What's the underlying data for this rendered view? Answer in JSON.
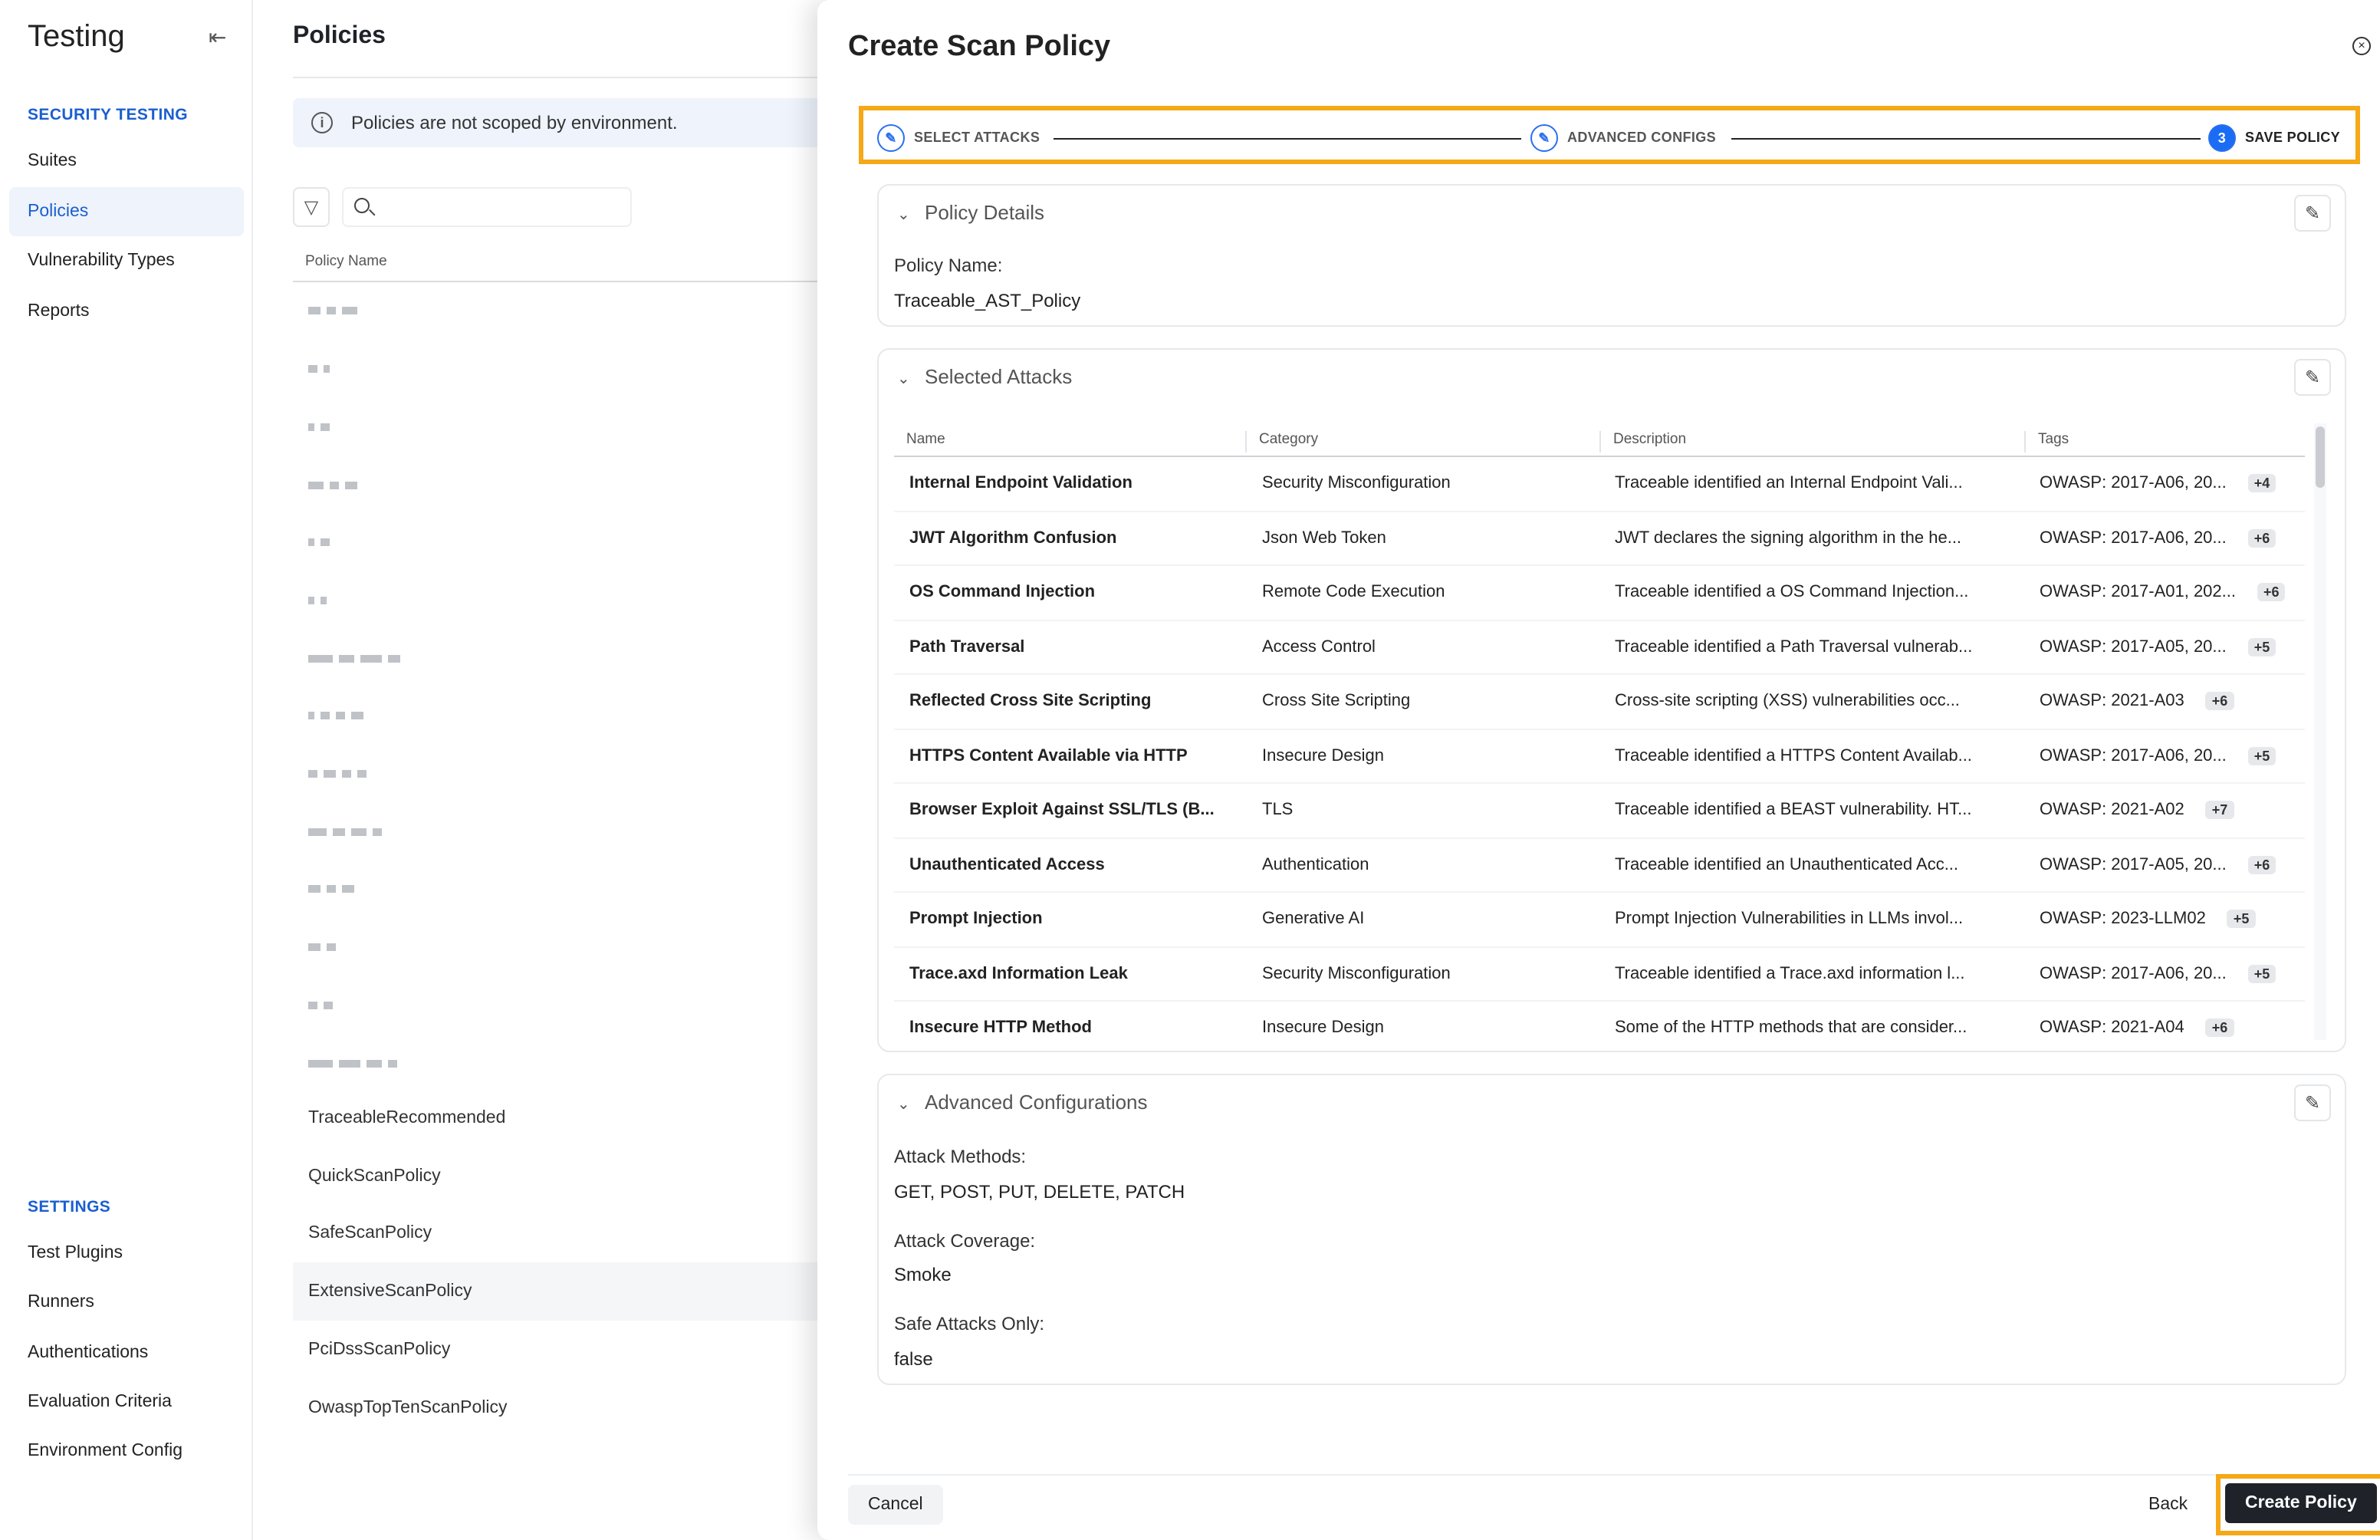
{
  "sidebar": {
    "title": "Testing",
    "section1": "SECURITY TESTING",
    "items1": [
      "Suites",
      "Policies",
      "Vulnerability Types",
      "Reports"
    ],
    "active": "Policies",
    "section2": "SETTINGS",
    "items2": [
      "Test Plugins",
      "Runners",
      "Authentications",
      "Evaluation Criteria",
      "Environment Config"
    ]
  },
  "policies": {
    "title": "Policies",
    "info": "Policies are not scoped by environment.",
    "search_placeholder": "",
    "column": "Policy Name",
    "visible_items": [
      "TraceableRecommended",
      "QuickScanPolicy",
      "SafeScanPolicy",
      "ExtensiveScanPolicy",
      "PciDssScanPolicy",
      "OwaspTopTenScanPolicy"
    ],
    "selected": "ExtensiveScanPolicy"
  },
  "drawer": {
    "title": "Create Scan Policy",
    "steps": [
      {
        "label": "SELECT ATTACKS",
        "state": "done"
      },
      {
        "label": "ADVANCED CONFIGS",
        "state": "done"
      },
      {
        "label": "SAVE POLICY",
        "number": "3",
        "state": "active"
      }
    ],
    "policy_details": {
      "title": "Policy Details",
      "name_label": "Policy Name:",
      "name_value": "Traceable_AST_Policy"
    },
    "selected_attacks": {
      "title": "Selected Attacks",
      "columns": [
        "Name",
        "Category",
        "Description",
        "Tags"
      ],
      "rows": [
        [
          "Internal Endpoint Validation",
          "Security Misconfiguration",
          "Traceable identified an Internal Endpoint Vali...",
          "OWASP: 2017-A06, 20...",
          "+4"
        ],
        [
          "JWT Algorithm Confusion",
          "Json Web Token",
          "JWT declares the signing algorithm in the he...",
          "OWASP: 2017-A06, 20...",
          "+6"
        ],
        [
          "OS Command Injection",
          "Remote Code Execution",
          "Traceable identified a OS Command Injection...",
          "OWASP: 2017-A01, 202...",
          "+6"
        ],
        [
          "Path Traversal",
          "Access Control",
          "Traceable identified a Path Traversal vulnerab...",
          "OWASP: 2017-A05, 20...",
          "+5"
        ],
        [
          "Reflected Cross Site Scripting",
          "Cross Site Scripting",
          "Cross-site scripting (XSS) vulnerabilities occ...",
          "OWASP: 2021-A03",
          "+6"
        ],
        [
          "HTTPS Content Available via HTTP",
          "Insecure Design",
          "Traceable identified a HTTPS Content Availab...",
          "OWASP: 2017-A06, 20...",
          "+5"
        ],
        [
          "Browser Exploit Against SSL/TLS (B...",
          "TLS",
          "Traceable identified a BEAST vulnerability. HT...",
          "OWASP: 2021-A02",
          "+7"
        ],
        [
          "Unauthenticated Access",
          "Authentication",
          "Traceable identified an Unauthenticated Acc...",
          "OWASP: 2017-A05, 20...",
          "+6"
        ],
        [
          "Prompt Injection",
          "Generative AI",
          "Prompt Injection Vulnerabilities in LLMs invol...",
          "OWASP: 2023-LLM02",
          "+5"
        ],
        [
          "Trace.axd Information Leak",
          "Security Misconfiguration",
          "Traceable identified a Trace.axd information l...",
          "OWASP: 2017-A06, 20...",
          "+5"
        ],
        [
          "Insecure HTTP Method",
          "Insecure Design",
          "Some of the HTTP methods that are consider...",
          "OWASP: 2021-A04",
          "+6"
        ]
      ]
    },
    "advanced": {
      "title": "Advanced Configurations",
      "methods_label": "Attack Methods:",
      "methods_value": "GET, POST, PUT, DELETE, PATCH",
      "coverage_label": "Attack Coverage:",
      "coverage_value": "Smoke",
      "safe_label": "Safe Attacks Only:",
      "safe_value": "false"
    },
    "buttons": {
      "cancel": "Cancel",
      "back": "Back",
      "create": "Create Policy"
    }
  },
  "colors": {
    "accent": "#1a6cf5",
    "highlight": "#f5a818",
    "primary_button": "#1f2329"
  }
}
